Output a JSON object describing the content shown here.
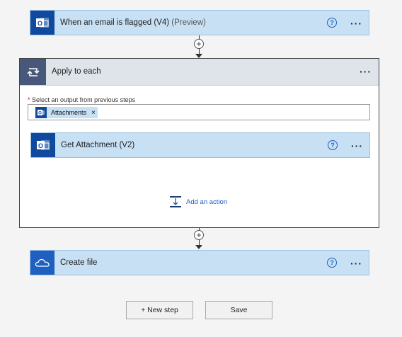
{
  "steps": {
    "trigger": {
      "title": "When an email is flagged (V4)",
      "subtitle": "(Preview)",
      "icon": "outlook-icon"
    },
    "apply_to_each": {
      "title": "Apply to each",
      "icon": "loop-icon"
    },
    "get_attachment": {
      "title": "Get Attachment (V2)",
      "icon": "outlook-icon"
    },
    "create_file": {
      "title": "Create file",
      "icon": "onedrive-icon"
    }
  },
  "apply_to_each_body": {
    "field_label": "Select an output from previous steps",
    "required_marker": "*",
    "token_label": "Attachments",
    "token_remove": "×",
    "add_action_label": "Add an action"
  },
  "common": {
    "help_glyph": "?",
    "more_glyph": "···",
    "plus_glyph": "+"
  },
  "buttons": {
    "new_step": "+ New step",
    "save": "Save"
  },
  "colors": {
    "card": "#c7e0f4",
    "outlook_blue": "#0f4a9e",
    "onedrive_blue": "#1f5fbf",
    "loop_slate": "#47587a"
  }
}
